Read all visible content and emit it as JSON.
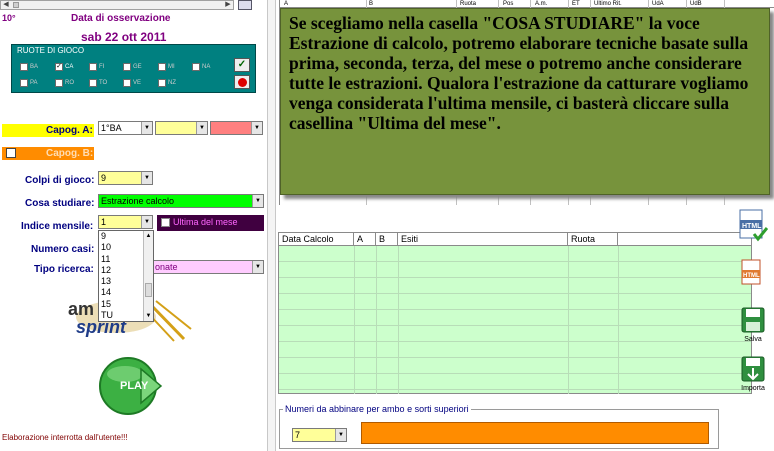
{
  "header": {
    "number": "10°",
    "obs_label": "Data di osservazione",
    "obs_date": "sab 22 ott 2011"
  },
  "ruote": {
    "title": "RUOTE DI GIOCO",
    "row1": [
      {
        "label": "BA",
        "checked": false
      },
      {
        "label": "CA",
        "checked": true
      },
      {
        "label": "FI",
        "checked": false
      },
      {
        "label": "GE",
        "checked": false
      },
      {
        "label": "MI",
        "checked": false
      },
      {
        "label": "NA",
        "checked": false
      }
    ],
    "row2": [
      {
        "label": "PA",
        "checked": false
      },
      {
        "label": "RO",
        "checked": false
      },
      {
        "label": "TO",
        "checked": false
      },
      {
        "label": "VE",
        "checked": false
      },
      {
        "label": "NZ",
        "checked": false
      }
    ]
  },
  "capog_a": {
    "label": "Capog. A:",
    "value1": "1°BA",
    "value2": "",
    "value3": ""
  },
  "capog_b": {
    "label": "Capog. B:"
  },
  "colpi": {
    "label": "Colpi di gioco:",
    "value": "9"
  },
  "cosa": {
    "label": "Cosa studiare:",
    "value": "Estrazione calcolo"
  },
  "indice": {
    "label": "Indice mensile:",
    "value": "1",
    "ultima_label": "Ultima del mese"
  },
  "numero_casi": {
    "label": "Numero casi:"
  },
  "tipo_ricerca": {
    "label": "Tipo ricerca:",
    "value_partial": "onate"
  },
  "listbox_items": [
    "9",
    "10",
    "11",
    "12",
    "13",
    "14",
    "15",
    "TU"
  ],
  "play_label": "PLAY",
  "status": "Elaborazione interrotta dall'utente!!!",
  "top_table_headers": [
    "A",
    "B",
    "Ruota",
    "Pos",
    "A.m.",
    "ET",
    "Ultimo Rit.",
    "UdA",
    "UdB"
  ],
  "note_text": "Se scegliamo nella casella \"COSA STUDIARE\" la voce Estrazione di calcolo, potremo elaborare tecniche basate sulla prima, seconda, terza, del mese o potremo anche considerare tutte le estrazioni. Qualora l'estrazione da catturare vogliamo venga considerata l'ultima mensile, ci basterà cliccare sulla casellina \"Ultima del mese\".",
  "grid_headers": [
    "Data Calcolo",
    "A",
    "B",
    "Esiti",
    "Ruota"
  ],
  "side_icons": [
    {
      "icon": "html-export-icon",
      "label": ""
    },
    {
      "icon": "html-file-icon",
      "label": ""
    },
    {
      "icon": "floppy-save-icon",
      "label": "Salva"
    },
    {
      "icon": "import-icon",
      "label": "Importa"
    }
  ],
  "ambo": {
    "legend": "Numeri da abbinare per ambo e sorti superiori",
    "value": "7"
  },
  "colors": {
    "note_bg": "#77933c",
    "grid_bg": "#ccffcc",
    "teal": "#008080",
    "accent_orange": "#ff8c00",
    "yellow": "#ffff00"
  }
}
